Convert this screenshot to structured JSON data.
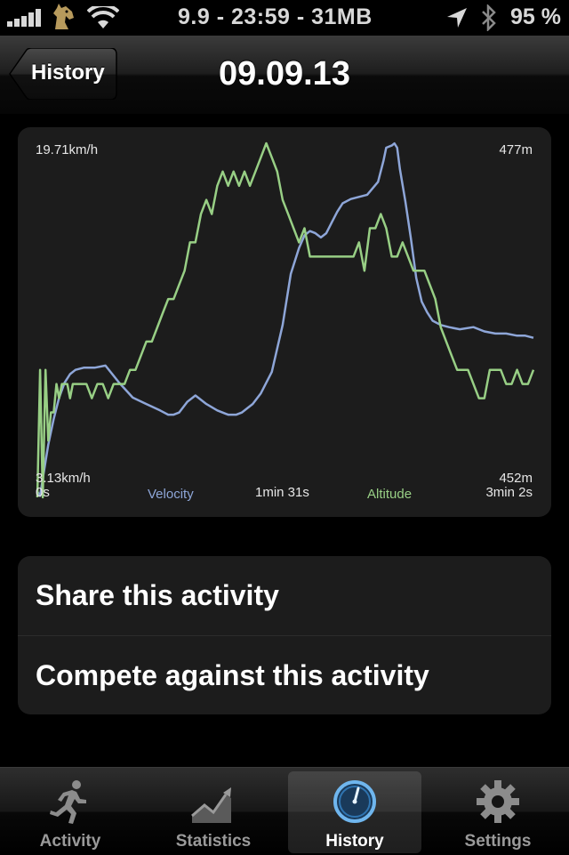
{
  "status_bar": {
    "center_text": "9.9 - 23:59 - 31MB",
    "battery": "95 %",
    "icons": [
      "signal-bars-icon",
      "carrier-horse-icon",
      "wifi-icon",
      "location-arrow-icon",
      "bluetooth-icon"
    ]
  },
  "nav": {
    "back_label": "History",
    "title": "09.09.13"
  },
  "chart_data": {
    "type": "line",
    "x_start_label": "0s",
    "x_mid_label": "1min 31s",
    "x_end_label": "3min 2s",
    "x_range_seconds": [
      0,
      182
    ],
    "velocity_max_label": "19.71km/h",
    "velocity_min_label": "3.13km/h",
    "velocity_range": [
      3.13,
      19.71
    ],
    "altitude_max_label": "477m",
    "altitude_min_label": "452m",
    "altitude_range": [
      452,
      477
    ],
    "series": [
      {
        "name": "Velocity",
        "axis": "velocity",
        "color": "#8ea6d8",
        "x": [
          0,
          1,
          2,
          3,
          4,
          6,
          8,
          10,
          12,
          14,
          17,
          21,
          25,
          30,
          35,
          40,
          45,
          48,
          50,
          52,
          55,
          58,
          62,
          66,
          70,
          73,
          75,
          77,
          79,
          82,
          86,
          90,
          93,
          96,
          98,
          100,
          102,
          103,
          104,
          106,
          108,
          110,
          112,
          115,
          118,
          121,
          125,
          127,
          128,
          130,
          131,
          132,
          133,
          135,
          137,
          139,
          141,
          143,
          145,
          148,
          151,
          155,
          160,
          164,
          168,
          172,
          176,
          179,
          182
        ],
        "values": [
          3.4,
          3.2,
          4.0,
          4.8,
          5.6,
          6.8,
          7.8,
          8.5,
          8.9,
          9.1,
          9.2,
          9.2,
          9.3,
          8.5,
          7.8,
          7.5,
          7.2,
          7.0,
          7.0,
          7.1,
          7.6,
          7.9,
          7.5,
          7.2,
          7.0,
          7.0,
          7.1,
          7.3,
          7.5,
          8.0,
          9.0,
          11.2,
          13.6,
          14.8,
          15.4,
          15.6,
          15.5,
          15.4,
          15.3,
          15.5,
          16.0,
          16.5,
          16.9,
          17.1,
          17.2,
          17.3,
          17.9,
          18.9,
          19.5,
          19.6,
          19.7,
          19.5,
          18.5,
          17.0,
          15.3,
          13.4,
          12.3,
          11.8,
          11.4,
          11.2,
          11.1,
          11.0,
          11.1,
          10.9,
          10.8,
          10.8,
          10.7,
          10.7,
          10.6
        ]
      },
      {
        "name": "Altitude",
        "axis": "altitude",
        "color": "#98cf85",
        "x": [
          0,
          1,
          2,
          3,
          4,
          5,
          6,
          7,
          8,
          9,
          10,
          11,
          12,
          13,
          14,
          16,
          18,
          20,
          22,
          24,
          26,
          28,
          30,
          32,
          34,
          36,
          38,
          40,
          42,
          44,
          46,
          48,
          50,
          52,
          54,
          56,
          58,
          60,
          62,
          64,
          66,
          68,
          70,
          72,
          74,
          76,
          78,
          80,
          82,
          84,
          86,
          88,
          90,
          92,
          94,
          96,
          98,
          100,
          102,
          104,
          106,
          108,
          110,
          112,
          114,
          116,
          118,
          120,
          122,
          124,
          126,
          128,
          130,
          132,
          134,
          136,
          138,
          140,
          142,
          144,
          146,
          148,
          150,
          152,
          154,
          156,
          158,
          160,
          162,
          164,
          166,
          168,
          170,
          172,
          174,
          176,
          178,
          180,
          182
        ],
        "values": [
          452,
          461,
          452,
          461,
          456,
          458,
          458,
          460,
          459,
          460,
          460,
          460,
          459,
          460,
          460,
          460,
          460,
          459,
          460,
          460,
          459,
          460,
          460,
          460,
          461,
          461,
          462,
          463,
          463,
          464,
          465,
          466,
          466,
          467,
          468,
          470,
          470,
          472,
          473,
          472,
          474,
          475,
          474,
          475,
          474,
          475,
          474,
          475,
          476,
          477,
          476,
          475,
          473,
          472,
          471,
          470,
          471,
          469,
          469,
          469,
          469,
          469,
          469,
          469,
          469,
          469,
          470,
          468,
          471,
          471,
          472,
          471,
          469,
          469,
          470,
          469,
          468,
          468,
          468,
          467,
          466,
          464,
          463,
          462,
          461,
          461,
          461,
          460,
          459,
          459,
          461,
          461,
          461,
          460,
          460,
          461,
          460,
          460,
          461
        ]
      }
    ]
  },
  "actions": [
    {
      "label": "Share this activity"
    },
    {
      "label": "Compete against this activity"
    }
  ],
  "tabs": [
    {
      "label": "Activity",
      "icon": "runner-icon",
      "selected": false
    },
    {
      "label": "Statistics",
      "icon": "trend-chart-icon",
      "selected": false
    },
    {
      "label": "History",
      "icon": "clock-icon",
      "selected": true
    },
    {
      "label": "Settings",
      "icon": "gear-icon",
      "selected": false
    }
  ]
}
